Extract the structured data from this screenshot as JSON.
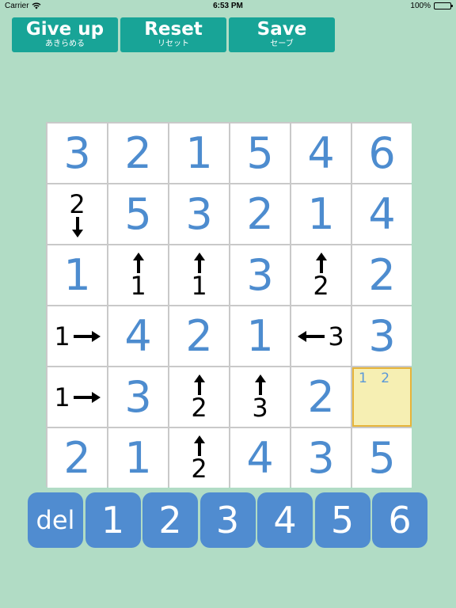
{
  "status_bar": {
    "carrier": "Carrier",
    "time": "6:53 PM",
    "battery": "100%"
  },
  "toolbar": {
    "give_up": {
      "label": "Give up",
      "sublabel": "あきらめる"
    },
    "reset": {
      "label": "Reset",
      "sublabel": "リセット"
    },
    "save": {
      "label": "Save",
      "sublabel": "セーブ"
    }
  },
  "colors": {
    "background": "#b1dcc5",
    "button": "#18a497",
    "keypad": "#508cd0",
    "number": "#4d8ccf",
    "selected_cell": "#f6efb3",
    "selected_border": "#e6b43a"
  },
  "grid": {
    "rows": [
      [
        {
          "type": "number",
          "value": "3"
        },
        {
          "type": "number",
          "value": "2"
        },
        {
          "type": "number",
          "value": "1"
        },
        {
          "type": "number",
          "value": "5"
        },
        {
          "type": "number",
          "value": "4"
        },
        {
          "type": "number",
          "value": "6"
        }
      ],
      [
        {
          "type": "clue",
          "value": "2",
          "arrow": "down"
        },
        {
          "type": "number",
          "value": "5"
        },
        {
          "type": "number",
          "value": "3"
        },
        {
          "type": "number",
          "value": "2"
        },
        {
          "type": "number",
          "value": "1"
        },
        {
          "type": "number",
          "value": "4"
        }
      ],
      [
        {
          "type": "number",
          "value": "1"
        },
        {
          "type": "clue",
          "value": "1",
          "arrow": "up"
        },
        {
          "type": "clue",
          "value": "1",
          "arrow": "up"
        },
        {
          "type": "number",
          "value": "3"
        },
        {
          "type": "clue",
          "value": "2",
          "arrow": "up"
        },
        {
          "type": "number",
          "value": "2"
        }
      ],
      [
        {
          "type": "clue",
          "value": "1",
          "arrow": "right"
        },
        {
          "type": "number",
          "value": "4"
        },
        {
          "type": "number",
          "value": "2"
        },
        {
          "type": "number",
          "value": "1"
        },
        {
          "type": "clue",
          "value": "3",
          "arrow": "left"
        },
        {
          "type": "number",
          "value": "3"
        }
      ],
      [
        {
          "type": "clue",
          "value": "1",
          "arrow": "right"
        },
        {
          "type": "number",
          "value": "3"
        },
        {
          "type": "clue",
          "value": "2",
          "arrow": "up"
        },
        {
          "type": "clue",
          "value": "3",
          "arrow": "up"
        },
        {
          "type": "number",
          "value": "2"
        },
        {
          "type": "memo",
          "value": "1 2",
          "selected": true
        }
      ],
      [
        {
          "type": "number",
          "value": "2"
        },
        {
          "type": "number",
          "value": "1"
        },
        {
          "type": "clue",
          "value": "2",
          "arrow": "up"
        },
        {
          "type": "number",
          "value": "4"
        },
        {
          "type": "number",
          "value": "3"
        },
        {
          "type": "number",
          "value": "5"
        }
      ]
    ]
  },
  "keypad": {
    "keys": [
      "del",
      "1",
      "2",
      "3",
      "4",
      "5",
      "6"
    ]
  }
}
